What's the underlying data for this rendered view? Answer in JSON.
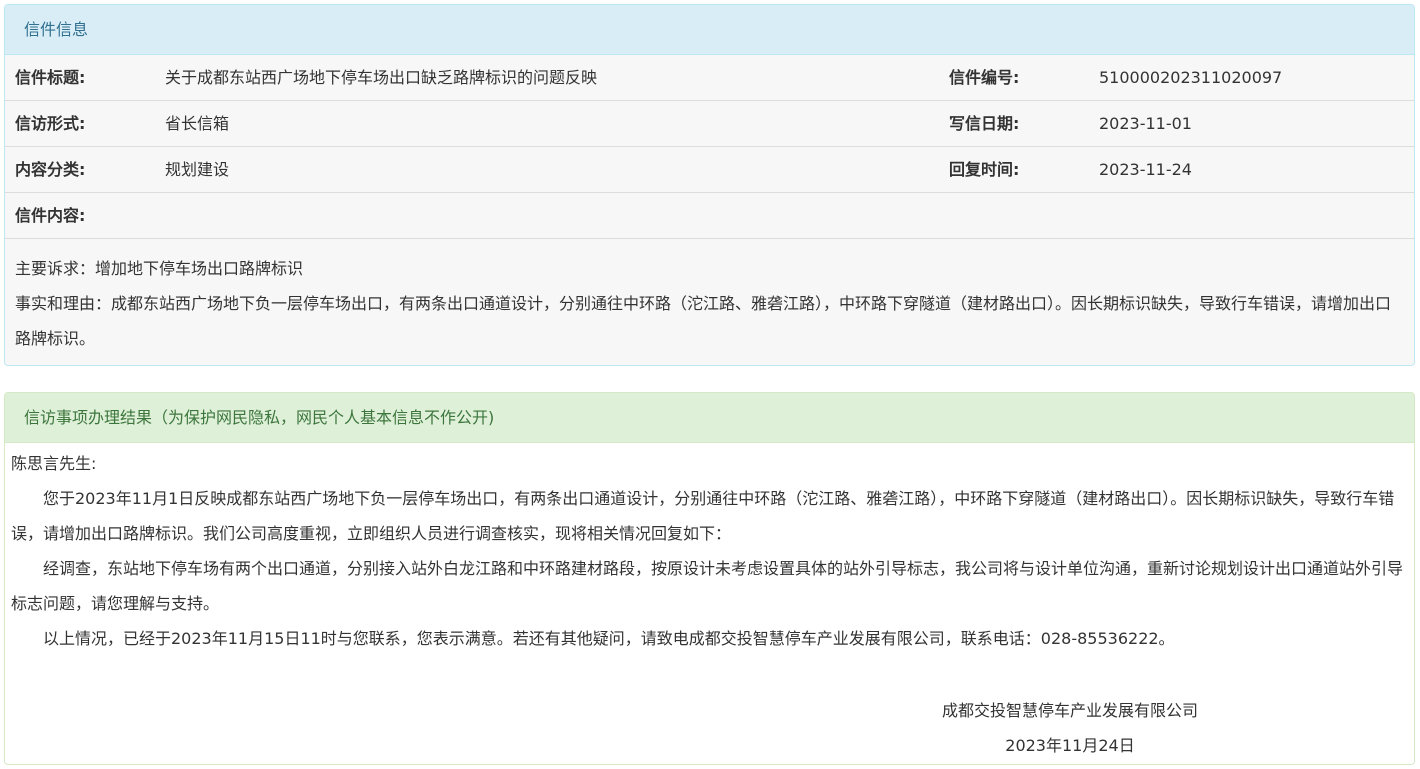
{
  "info_panel": {
    "heading": "信件信息",
    "rows": [
      {
        "label1": "信件标题:",
        "value1": "关于成都东站西广场地下停车场出口缺乏路牌标识的问题反映",
        "label2": "信件编号:",
        "value2": "510000202311020097"
      },
      {
        "label1": "信访形式:",
        "value1": "省长信箱",
        "label2": "写信日期:",
        "value2": "2023-11-01"
      },
      {
        "label1": "内容分类:",
        "value1": "规划建设",
        "label2": "回复时间:",
        "value2": "2023-11-24"
      }
    ],
    "content_label": "信件内容:",
    "content_lines": [
      "主要诉求：增加地下停车场出口路牌标识",
      "事实和理由：成都东站西广场地下负一层停车场出口，有两条出口通道设计，分别通往中环路（沱江路、雅砻江路），中环路下穿隧道（建材路出口）。因长期标识缺失，导致行车错误，请增加出口路牌标识。"
    ]
  },
  "result_panel": {
    "heading": "信访事项办理结果（为保护网民隐私，网民个人基本信息不作公开)",
    "greeting": "陈思言先生:",
    "paragraphs": [
      "您于2023年11月1日反映成都东站西广场地下负一层停车场出口，有两条出口通道设计，分别通往中环路（沱江路、雅砻江路），中环路下穿隧道（建材路出口）。因长期标识缺失，导致行车错误，请增加出口路牌标识。我们公司高度重视，立即组织人员进行调查核实，现将相关情况回复如下：",
      "经调查，东站地下停车场有两个出口通道，分别接入站外白龙江路和中环路建材路段，按原设计未考虑设置具体的站外引导标志，我公司将与设计单位沟通，重新讨论规划设计出口通道站外引导标志问题，请您理解与支持。",
      "以上情况，已经于2023年11月15日11时与您联系，您表示满意。若还有其他疑问，请致电成都交投智慧停车产业发展有限公司，联系电话：028-85536222。"
    ],
    "signature_org": "成都交投智慧停车产业发展有限公司",
    "signature_date": "2023年11月24日"
  }
}
